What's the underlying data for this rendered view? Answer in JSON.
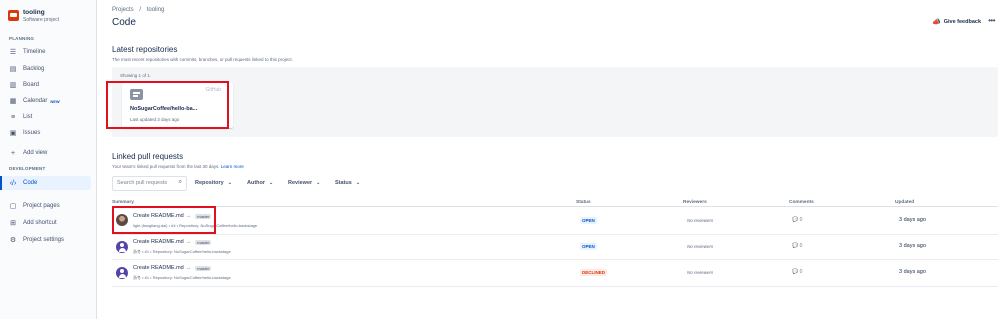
{
  "project": {
    "name": "tooling",
    "type": "Software project"
  },
  "sidebar": {
    "planning_label": "PLANNING",
    "planning_items": [
      {
        "label": "Timeline",
        "icon": "timeline-icon"
      },
      {
        "label": "Backlog",
        "icon": "backlog-icon"
      },
      {
        "label": "Board",
        "icon": "board-icon"
      },
      {
        "label": "Calendar",
        "icon": "calendar-icon",
        "badge": "NEW"
      },
      {
        "label": "List",
        "icon": "list-icon"
      },
      {
        "label": "Issues",
        "icon": "issues-icon"
      }
    ],
    "add_view": "Add view",
    "development_label": "DEVELOPMENT",
    "code": "Code",
    "project_pages": "Project pages",
    "add_shortcut": "Add shortcut",
    "project_settings": "Project settings"
  },
  "header": {
    "crumb_projects": "Projects",
    "crumb_sep": "/",
    "crumb_tooling": "tooling",
    "title": "Code",
    "feedback": "Give feedback",
    "more": "•••"
  },
  "repos": {
    "heading": "Latest repositories",
    "subheading": "The most recent repositories with commits, branches, or pull requests linked to this project.",
    "showing": "Showing 1 of 1.",
    "card": {
      "source": "GitHub",
      "name": "NoSugarCoffee/hello-ba...",
      "updated": "Last updated 3 days ago"
    }
  },
  "prs": {
    "heading": "Linked pull requests",
    "subheading": "Your team's linked pull requests from the last 30 days.",
    "learn_more": "Learn more",
    "search_placeholder": "Search pull requests",
    "filters": [
      "Repository",
      "Author",
      "Reviewer",
      "Status"
    ],
    "columns": {
      "summary": "Summary",
      "status": "Status",
      "reviewers": "Reviewers",
      "comments": "Comments",
      "updated": "Updated"
    },
    "rows": [
      {
        "title": "Create README.md",
        "branch": "master",
        "meta": "light (liangliang.dai) • #4 • Repository: NoSugarCoffee/hello-backstage",
        "status": "OPEN",
        "reviewers": "No reviewers",
        "comments": "0",
        "updated": "3 days ago"
      },
      {
        "title": "Create README.md",
        "branch": "master",
        "meta": "浙冬 • #1 • Repository: NoSugarCoffee/hello-backstage",
        "status": "OPEN",
        "reviewers": "No reviewers",
        "comments": "0",
        "updated": "3 days ago"
      },
      {
        "title": "Create README.md",
        "branch": "master",
        "meta": "浙冬 • #1 • Repository: NoSugarCoffee/hello-backstage",
        "status": "DECLINED",
        "reviewers": "No reviewers",
        "comments": "0",
        "updated": "3 days ago"
      }
    ]
  },
  "colors": {
    "accent": "#0052cc",
    "highlight": "#e0101f",
    "declined": "#de350b"
  }
}
